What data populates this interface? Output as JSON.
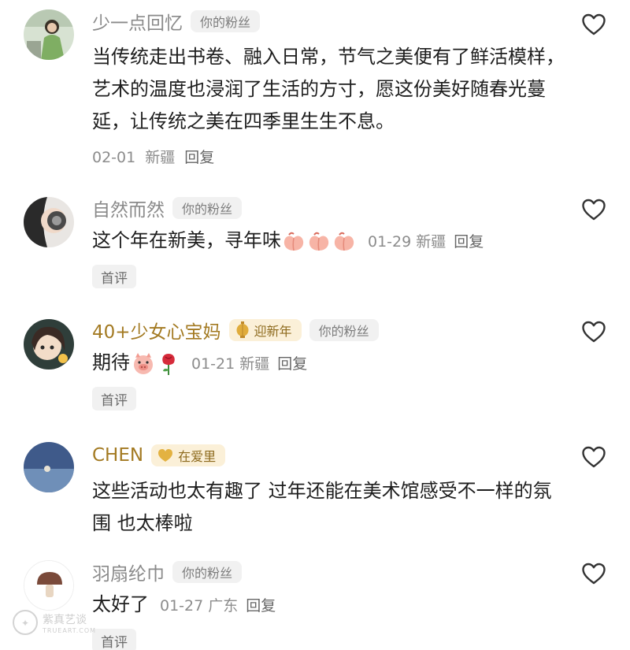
{
  "colors": {
    "like_icon": "#333333",
    "name_gray": "#8a8a8a",
    "name_gold": "#a37a22",
    "tag_bg": "#f1f1f1"
  },
  "comments": [
    {
      "username": "少一点回忆",
      "tag": "你的粉丝",
      "text": "当传统走出书卷、融入日常，节气之美便有了鲜活模样，艺术的温度也浸润了生活的方寸，愿这份美好随春光蔓延，让传统之美在四季里生生不息。",
      "date": "02-01",
      "location": "新疆",
      "reply": "回复"
    },
    {
      "username": "自然而然",
      "tag": "你的粉丝",
      "text": "这个年在新美，寻年味",
      "emojis": [
        "peach-emoji",
        "peach-emoji",
        "peach-emoji"
      ],
      "date": "01-29",
      "location": "新疆",
      "reply": "回复",
      "first_label": "首评"
    },
    {
      "username": "40+少女心宝妈",
      "badge": "迎新年",
      "badge_icon": "lantern-icon",
      "tag": "你的粉丝",
      "text": "期待",
      "emojis": [
        "pig-emoji",
        "rose-emoji"
      ],
      "date": "01-21",
      "location": "新疆",
      "reply": "回复",
      "first_label": "首评"
    },
    {
      "username": "CHEN",
      "badge": "在爱里",
      "badge_icon": "heart-badge-icon",
      "text": "这些活动也太有趣了 过年还能在美术馆感受不一样的氛围 也太棒啦"
    },
    {
      "username": "羽扇纶巾",
      "tag": "你的粉丝",
      "text": "太好了",
      "date": "01-27",
      "location": "广东",
      "reply": "回复",
      "first_label": "首评"
    }
  ],
  "watermark": {
    "main": "紫真艺谈",
    "sub": "TRUEART.COM"
  }
}
